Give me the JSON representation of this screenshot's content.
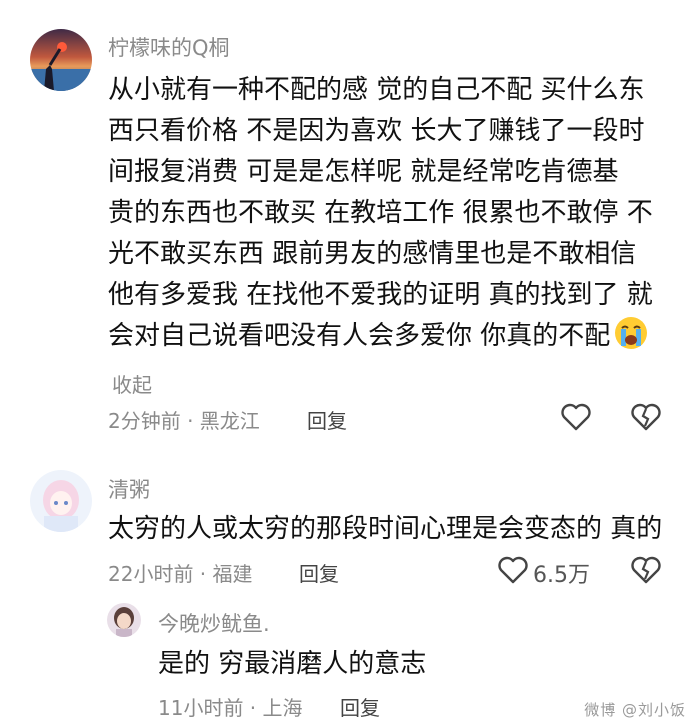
{
  "comments": [
    {
      "username": "柠檬味的Q桐",
      "lines": [
        "从小就有一种不配的感  觉的自己不配  买什么东",
        "西只看价格  不是因为喜欢  长大了赚钱了一段时",
        "间报复消费  可是是怎样呢  就是经常吃肯德基",
        "贵的东西也不敢买  在教培工作  很累也不敢停  不",
        "光不敢买东西  跟前男友的感情里也是不敢相信",
        "他有多爱我  在找他不爱我的证明  真的找到了  就",
        "会对自己说看吧没有人会多爱你  你真的不配"
      ],
      "emoji": "crying-face",
      "collapse_label": "收起",
      "time_location": "2分钟前 · 黑龙江",
      "reply_label": "回复"
    },
    {
      "username": "清粥",
      "lines": [
        "太穷的人或太穷的那段时间心理是会变态的  真的"
      ],
      "time_location": "22小时前 · 福建",
      "reply_label": "回复",
      "like_count": "6.5万"
    },
    {
      "username": "今晚炒鱿鱼.",
      "lines": [
        "是的  穷最消磨人的意志"
      ],
      "time_location": "11小时前 · 上海",
      "reply_label": "回复"
    }
  ],
  "watermark": "微博 @刘小饭",
  "colors": {
    "meta_gray": "#8a8a8a",
    "text": "#111111"
  }
}
